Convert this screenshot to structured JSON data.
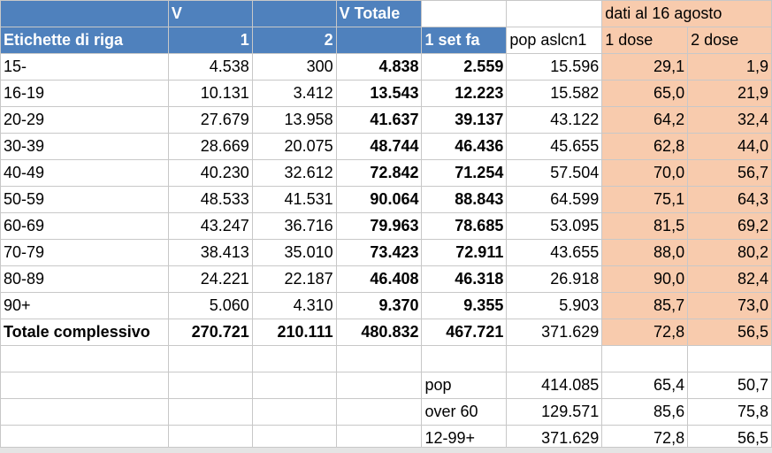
{
  "header_row1": {
    "col2": "V",
    "col4": "V Totale",
    "col7": "dati al 16 agosto"
  },
  "header_row2": [
    "Etichette di riga",
    "1",
    "2",
    "",
    "1 set fa",
    "pop aslcn1",
    "1 dose",
    "2 dose"
  ],
  "rows": [
    [
      "15-",
      "4.538",
      "300",
      "4.838",
      "2.559",
      "15.596",
      "29,1",
      "1,9"
    ],
    [
      "16-19",
      "10.131",
      "3.412",
      "13.543",
      "12.223",
      "15.582",
      "65,0",
      "21,9"
    ],
    [
      "20-29",
      "27.679",
      "13.958",
      "41.637",
      "39.137",
      "43.122",
      "64,2",
      "32,4"
    ],
    [
      "30-39",
      "28.669",
      "20.075",
      "48.744",
      "46.436",
      "45.655",
      "62,8",
      "44,0"
    ],
    [
      "40-49",
      "40.230",
      "32.612",
      "72.842",
      "71.254",
      "57.504",
      "70,0",
      "56,7"
    ],
    [
      "50-59",
      "48.533",
      "41.531",
      "90.064",
      "88.843",
      "64.599",
      "75,1",
      "64,3"
    ],
    [
      "60-69",
      "43.247",
      "36.716",
      "79.963",
      "78.685",
      "53.095",
      "81,5",
      "69,2"
    ],
    [
      "70-79",
      "38.413",
      "35.010",
      "73.423",
      "72.911",
      "43.655",
      "88,0",
      "80,2"
    ],
    [
      "80-89",
      "24.221",
      "22.187",
      "46.408",
      "46.318",
      "26.918",
      "90,0",
      "82,4"
    ],
    [
      "90+",
      "5.060",
      "4.310",
      "9.370",
      "9.355",
      "5.903",
      "85,7",
      "73,0"
    ]
  ],
  "total": [
    "Totale complessivo",
    "270.721",
    "210.111",
    "480.832",
    "467.721",
    "371.629",
    "72,8",
    "56,5"
  ],
  "summary": [
    [
      "pop",
      "414.085",
      "65,4",
      "50,7"
    ],
    [
      "over 60",
      "129.571",
      "85,6",
      "75,8"
    ],
    [
      "12-99+",
      "371.629",
      "72,8",
      "56,5"
    ]
  ],
  "colors": {
    "header": "#4f81bd",
    "highlight": "#f8cbad",
    "grid": "#c8c8c8"
  }
}
